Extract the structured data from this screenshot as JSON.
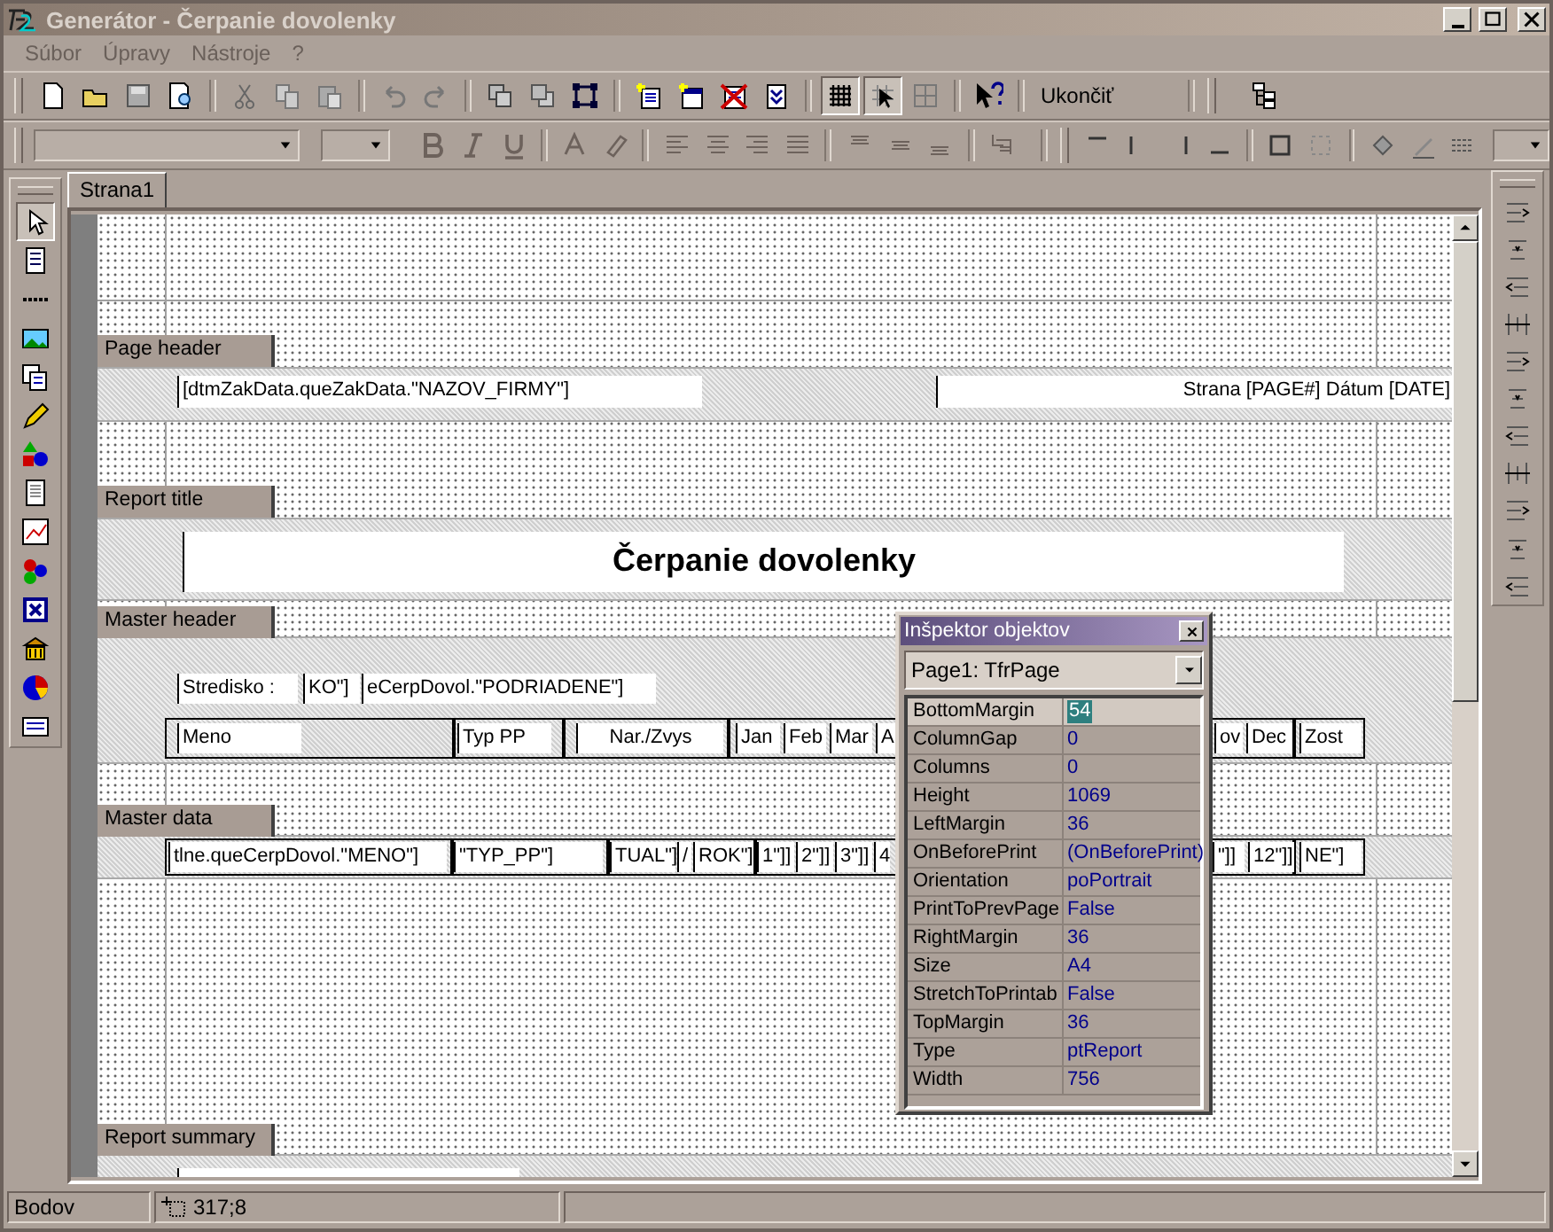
{
  "window": {
    "title": "Generátor - Čerpanie dovolenky"
  },
  "menu": [
    "Súbor",
    "Úpravy",
    "Nástroje",
    "?"
  ],
  "toolbar": {
    "grid_pressed": true,
    "snap_pressed": true,
    "exit_button": "Ukončiť"
  },
  "tools_palette": {
    "pointer_pressed": true
  },
  "tabs": [
    {
      "label": "Strana1",
      "selected": true
    }
  ],
  "report": {
    "bands": [
      {
        "label": "Page header",
        "objects": [
          {
            "text": "[dtmZakData.queZakData.\"NAZOV_FIRMY\"]"
          },
          {
            "text": "Strana [PAGE#]   Dátum [DATE]"
          }
        ]
      },
      {
        "label": "Report title",
        "objects": [
          {
            "text": "Čerpanie dovolenky"
          }
        ]
      },
      {
        "label": "Master header",
        "objects": [
          {
            "text": "Stredisko :"
          },
          {
            "text": "KO\"]"
          },
          {
            "text": "eCerpDovol.\"PODRIADENE\"]"
          },
          {
            "text": "Meno"
          },
          {
            "text": "Typ PP"
          },
          {
            "text": "Nar./Zvys"
          },
          {
            "text": "Jan"
          },
          {
            "text": "Feb"
          },
          {
            "text": "Mar"
          },
          {
            "text": "A"
          },
          {
            "text": "ov"
          },
          {
            "text": "Dec"
          },
          {
            "text": "Zost"
          }
        ]
      },
      {
        "label": "Master data",
        "objects": [
          {
            "text": "tlne.queCerpDovol.\"MENO\"]"
          },
          {
            "text": "\"TYP_PP\"]"
          },
          {
            "text": "TUAL\"]"
          },
          {
            "text": "/"
          },
          {
            "text": "ROK\"]"
          },
          {
            "text": "1\"]]"
          },
          {
            "text": "2\"]]"
          },
          {
            "text": "3\"]]"
          },
          {
            "text": "4"
          },
          {
            "text": "\"]]"
          },
          {
            "text": "12\"]]"
          },
          {
            "text": "NE\"]"
          }
        ]
      },
      {
        "label": "Report summary"
      }
    ]
  },
  "inspector": {
    "title": "Inšpektor objektov",
    "object": "Page1: TfrPage",
    "properties": [
      {
        "name": "BottomMargin",
        "value": "54",
        "selected": true
      },
      {
        "name": "ColumnGap",
        "value": "0",
        "selected": false
      },
      {
        "name": "Columns",
        "value": "0",
        "selected": false
      },
      {
        "name": "Height",
        "value": "1069",
        "selected": false
      },
      {
        "name": "LeftMargin",
        "value": "36",
        "selected": false
      },
      {
        "name": "OnBeforePrint",
        "value": "(OnBeforePrint)",
        "selected": false
      },
      {
        "name": "Orientation",
        "value": "poPortrait",
        "selected": false
      },
      {
        "name": "PrintToPrevPage",
        "value": "False",
        "selected": false
      },
      {
        "name": "RightMargin",
        "value": "36",
        "selected": false
      },
      {
        "name": "Size",
        "value": "A4",
        "selected": false
      },
      {
        "name": "StretchToPrintab",
        "value": "False",
        "selected": false
      },
      {
        "name": "TopMargin",
        "value": "36",
        "selected": false
      },
      {
        "name": "Type",
        "value": "ptReport",
        "selected": false
      },
      {
        "name": "Width",
        "value": "756",
        "selected": false
      }
    ]
  },
  "status_bar": {
    "mode": "Bodov",
    "position": "317;8"
  }
}
